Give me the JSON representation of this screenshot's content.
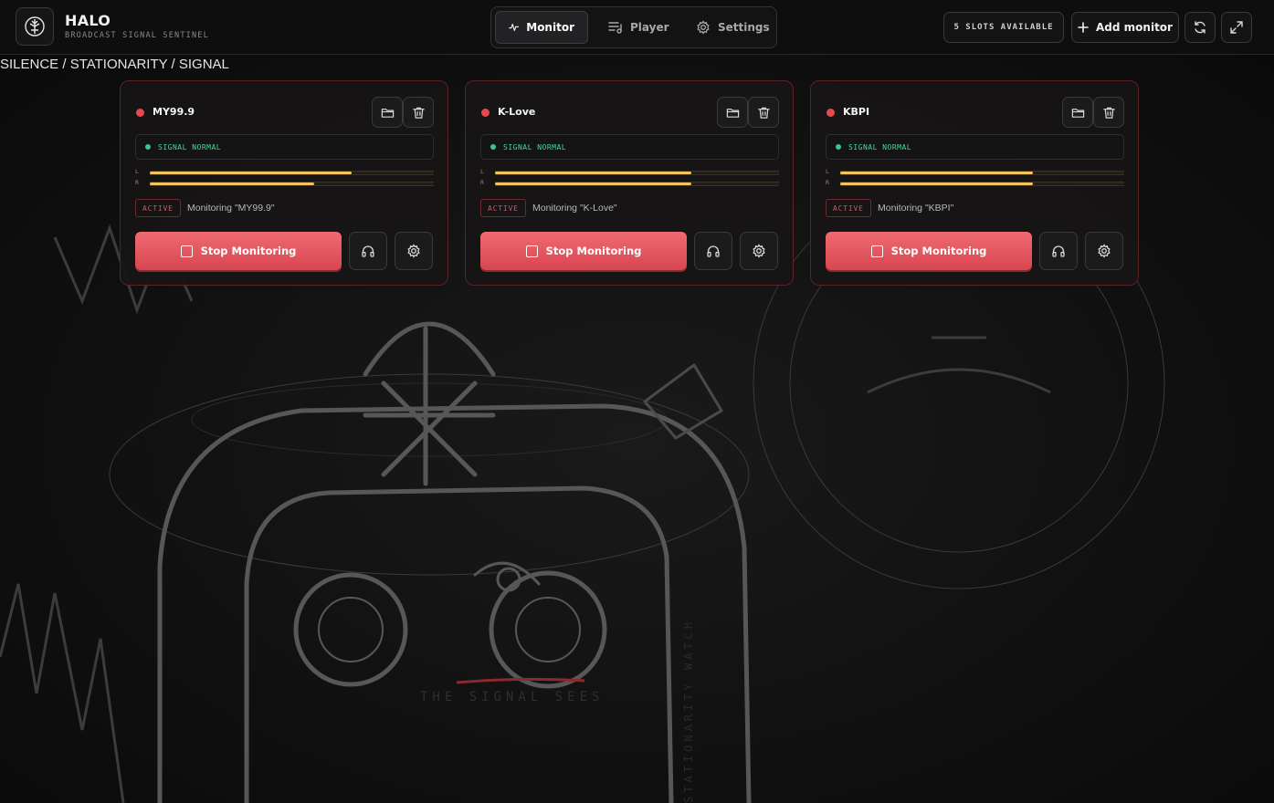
{
  "app": {
    "title": "HALO",
    "subtitle": "BROADCAST SIGNAL SENTINEL",
    "logo_icon": "trident-icon"
  },
  "nav": {
    "tabs": [
      {
        "label": "Monitor",
        "icon": "pulse-icon",
        "active": true
      },
      {
        "label": "Player",
        "icon": "playlist-icon",
        "active": false
      },
      {
        "label": "Settings",
        "icon": "gear-icon",
        "active": false
      }
    ]
  },
  "header_actions": {
    "slots_label": "5 SLOTS AVAILABLE",
    "add_label": "Add monitor",
    "refresh_icon": "refresh-icon",
    "fullscreen_icon": "expand-icon"
  },
  "breadcrumb": "SILENCE / STATIONARITY / SIGNAL",
  "monitors": [
    {
      "name": "MY99.9",
      "status": "SIGNAL NORMAL",
      "level_l": 0.71,
      "level_r": 0.58,
      "badge": "ACTIVE",
      "message": "Monitoring \"MY99.9\"",
      "stop_label": "Stop Monitoring"
    },
    {
      "name": "K-Love",
      "status": "SIGNAL NORMAL",
      "level_l": 0.69,
      "level_r": 0.69,
      "badge": "ACTIVE",
      "message": "Monitoring \"K-Love\"",
      "stop_label": "Stop Monitoring"
    },
    {
      "name": "KBPI",
      "status": "SIGNAL NORMAL",
      "level_l": 0.68,
      "level_r": 0.68,
      "badge": "ACTIVE",
      "message": "Monitoring \"KBPI\"",
      "stop_label": "Stop Monitoring"
    }
  ],
  "meter_labels": {
    "left": "L",
    "right": "R"
  },
  "colors": {
    "accent_red": "#e5484d",
    "signal_green": "#4bd69a",
    "meter_yellow": "#f2c45a"
  }
}
